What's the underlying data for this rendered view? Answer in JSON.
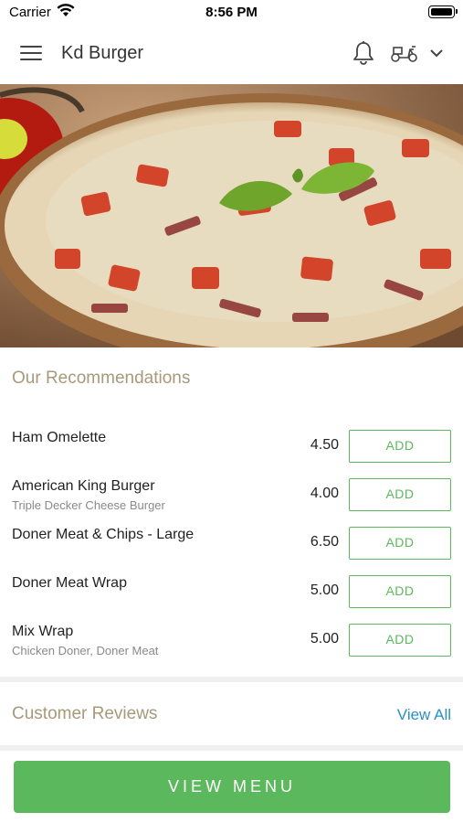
{
  "status_bar": {
    "carrier": "Carrier",
    "time": "8:56 PM"
  },
  "header": {
    "title": "Kd Burger",
    "icons": [
      "menu-icon",
      "bell-icon",
      "scooter-icon",
      "chevron-down-icon"
    ]
  },
  "hero": {
    "image": "pizza-photo"
  },
  "recommendations": {
    "title": "Our Recommendations",
    "items": [
      {
        "name": "Ham Omelette",
        "description": "",
        "price": "4.50",
        "button": "ADD"
      },
      {
        "name": "American King Burger",
        "description": "Triple Decker Cheese Burger",
        "price": "4.00",
        "button": "ADD"
      },
      {
        "name": "Doner Meat & Chips - Large",
        "description": "",
        "price": "6.50",
        "button": "ADD"
      },
      {
        "name": "Doner Meat Wrap",
        "description": "",
        "price": "5.00",
        "button": "ADD"
      },
      {
        "name": "Mix Wrap",
        "description": "Chicken Doner, Doner Meat",
        "price": "5.00",
        "button": "ADD"
      }
    ]
  },
  "reviews": {
    "title": "Customer Reviews",
    "view_all": "View All"
  },
  "footer": {
    "button": "VIEW MENU"
  },
  "colors": {
    "accent_green": "#5cb85c",
    "link_blue": "#2a8fc7",
    "section_title": "#a8997a"
  }
}
